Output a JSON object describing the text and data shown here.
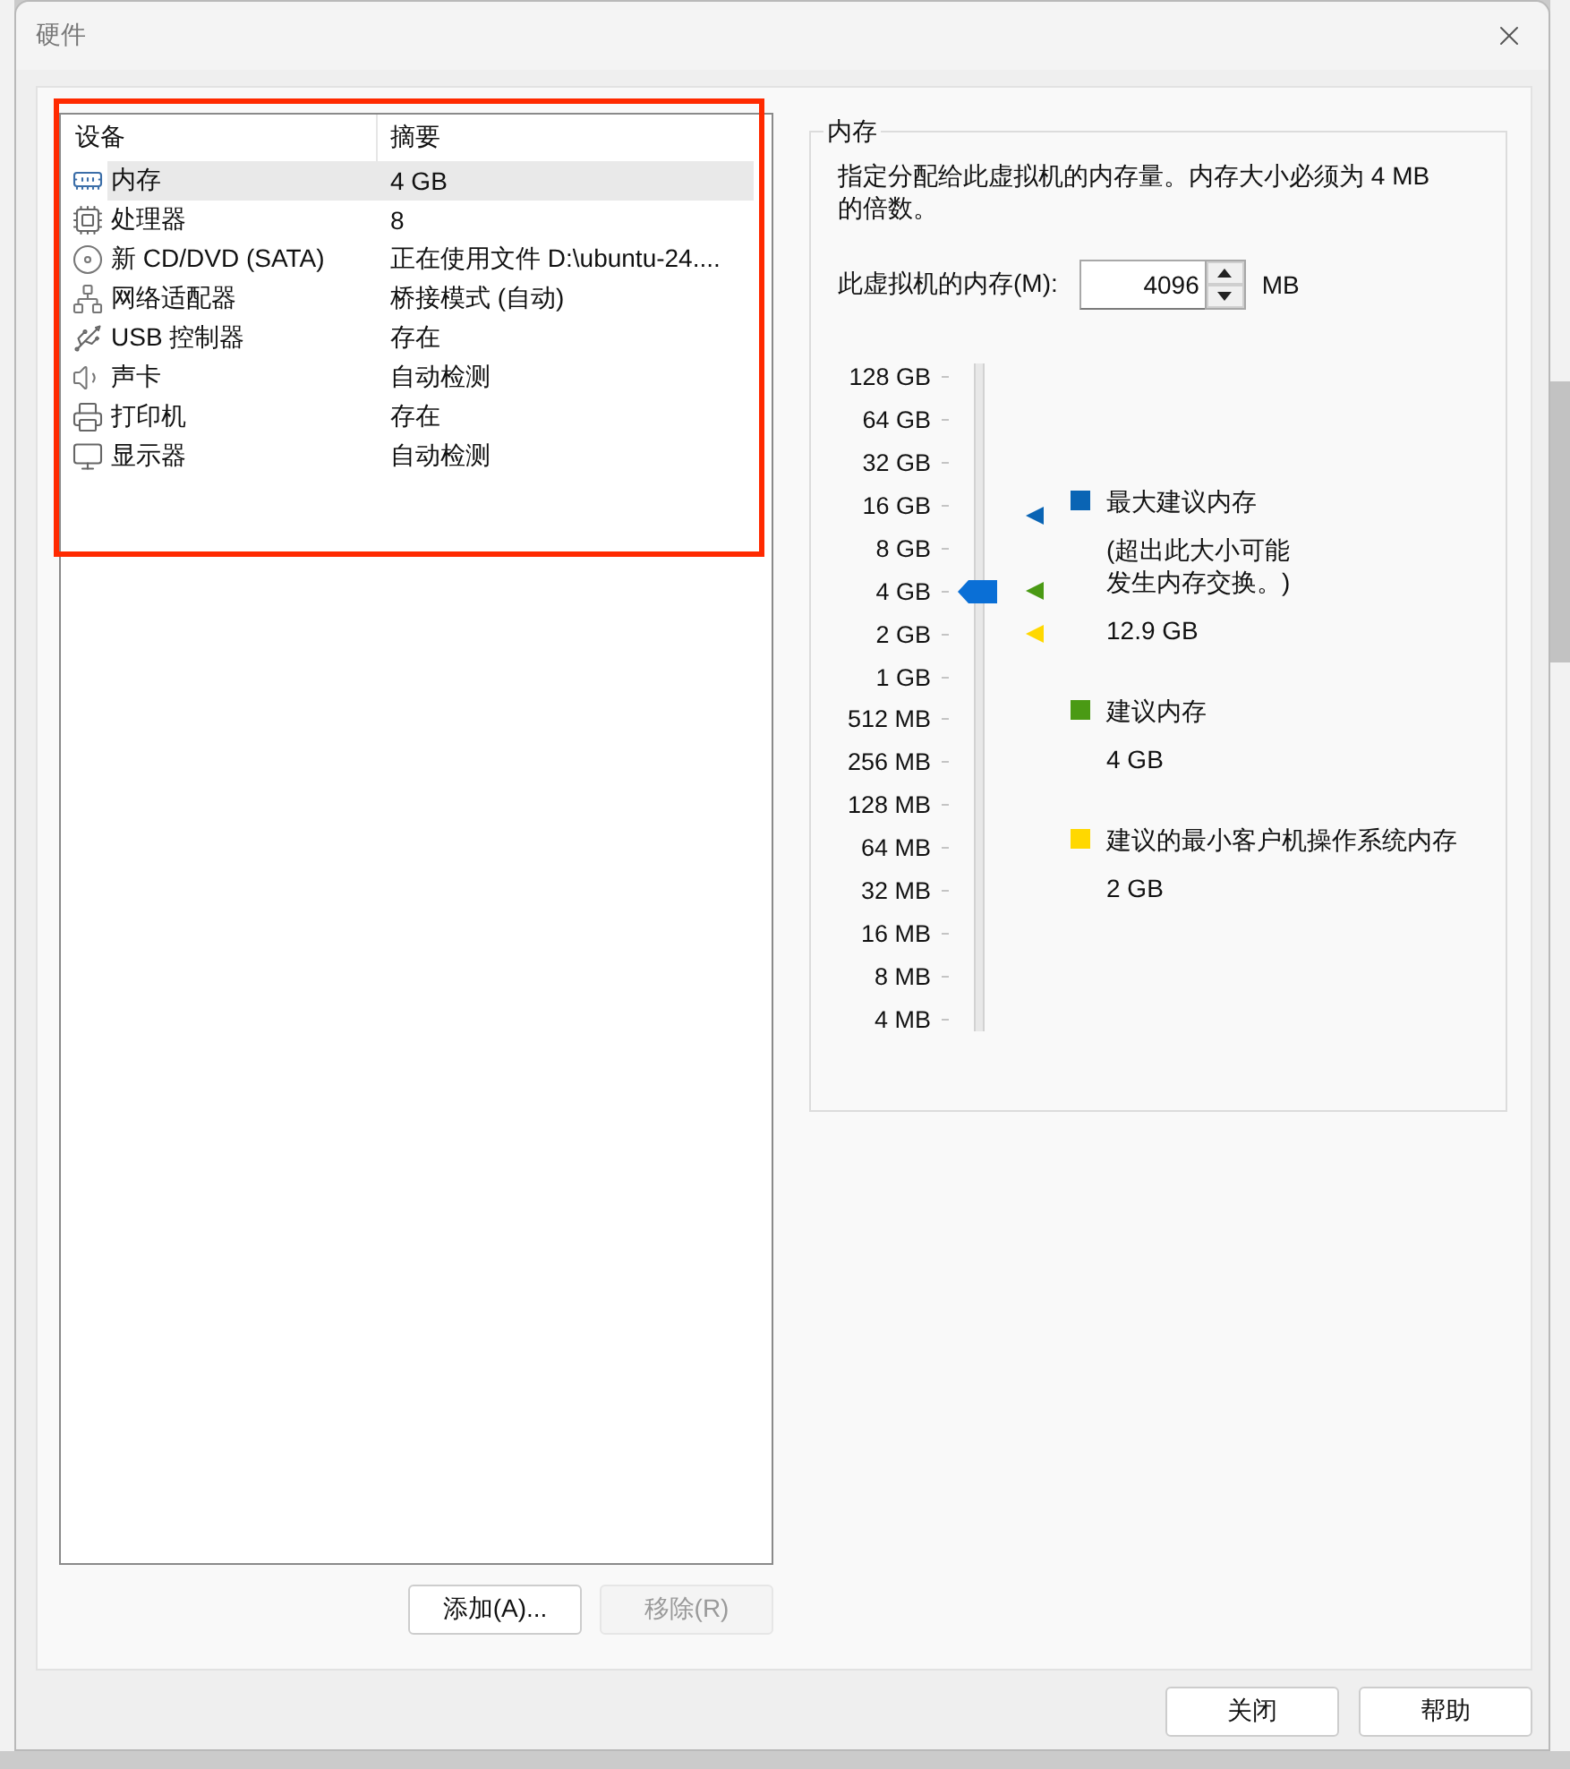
{
  "window": {
    "title": "硬件"
  },
  "device_list": {
    "highlighted": true,
    "columns": [
      "设备",
      "摘要"
    ],
    "devices": [
      {
        "kind": "memory",
        "name": "内存",
        "summary": "4 GB",
        "selected": true
      },
      {
        "kind": "processor",
        "name": "处理器",
        "summary": "8",
        "selected": false
      },
      {
        "kind": "cdrom",
        "name": "新 CD/DVD (SATA)",
        "summary": "正在使用文件 D:\\ubuntu-24....",
        "selected": false
      },
      {
        "kind": "network",
        "name": "网络适配器",
        "summary": "桥接模式 (自动)",
        "selected": false
      },
      {
        "kind": "usb",
        "name": "USB 控制器",
        "summary": "存在",
        "selected": false
      },
      {
        "kind": "sound",
        "name": "声卡",
        "summary": "自动检测",
        "selected": false
      },
      {
        "kind": "printer",
        "name": "打印机",
        "summary": "存在",
        "selected": false
      },
      {
        "kind": "display",
        "name": "显示器",
        "summary": "自动检测",
        "selected": false
      }
    ]
  },
  "list_buttons": [
    {
      "label": "添加(A)...",
      "disabled": false
    },
    {
      "label": "移除(R)",
      "disabled": true
    }
  ],
  "memory": {
    "title": "内存",
    "description": "指定分配给此虚拟机的内存量。内存大小必须为 4 MB 的倍数。",
    "field_label": "此虚拟机的内存(M):",
    "value": "4096",
    "unit": "MB",
    "slider": {
      "level": 0.667,
      "scale": [
        "128 GB",
        "64 GB",
        "32 GB",
        "16 GB",
        "8 GB",
        "4 GB",
        "2 GB",
        "1 GB",
        "512 MB",
        "256 MB",
        "128 MB",
        "64 MB",
        "32 MB",
        "16 MB",
        "8 MB",
        "4 MB"
      ],
      "markers": [
        {
          "color": "#0a64b4",
          "level": 0.785
        },
        {
          "color": "#4a9a14",
          "level": 0.667
        },
        {
          "color": "#ffd800",
          "level": 0.6
        }
      ]
    },
    "legend": [
      {
        "color": "#0a64b4",
        "label": "最大建议内存",
        "note": "(超出此大小可能发生内存交换。)",
        "value": "12.9 GB"
      },
      {
        "color": "#4a9a14",
        "label": "建议内存",
        "value": "4 GB"
      },
      {
        "color": "#ffd800",
        "label": "建议的最小客户机操作系统内存",
        "value": "2 GB"
      }
    ]
  },
  "footer_buttons": [
    "关闭",
    "帮助"
  ]
}
